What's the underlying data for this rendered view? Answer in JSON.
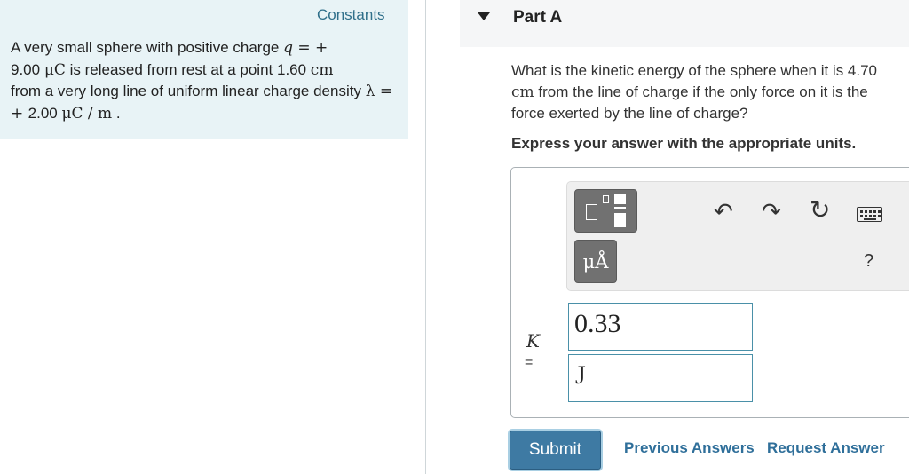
{
  "left_panel": {
    "constants_label": "Constants",
    "problem": {
      "t1": "A very small sphere with positive charge ",
      "q_var": "q",
      "q_eq": " = +",
      "q_value": "9.00 ",
      "q_unit": "μC",
      "t2": " is released from rest at a point 1.60 ",
      "dist_unit": "cm",
      "t3": " from a very long line of uniform linear charge density ",
      "lambda_var": "λ",
      "lambda_eq": " = + ",
      "lambda_value": "2.00 ",
      "lambda_unit": "μC / m",
      "t4": " ."
    }
  },
  "part": {
    "title": "Part A",
    "question_l1": "What is the kinetic energy of the sphere when it is 4.70",
    "question_l2_unit": "cm",
    "question_l2": " from the line of charge if the only force on it is the",
    "question_l3": "force exerted by the line of charge?",
    "instruction": "Express your answer with the appropriate units."
  },
  "answer": {
    "units_button_label": "μÅ",
    "help_label": "?",
    "variable": "K",
    "equals": "=",
    "value": "0.33",
    "unit": "J"
  },
  "actions": {
    "submit_label": "Submit",
    "previous_answers_label": "Previous Answers",
    "request_answer_label": "Request Answer"
  },
  "icons": {
    "templates": "templates-icon",
    "undo": "undo-icon",
    "redo": "redo-icon",
    "reset": "reset-icon",
    "keyboard": "keyboard-icon"
  }
}
